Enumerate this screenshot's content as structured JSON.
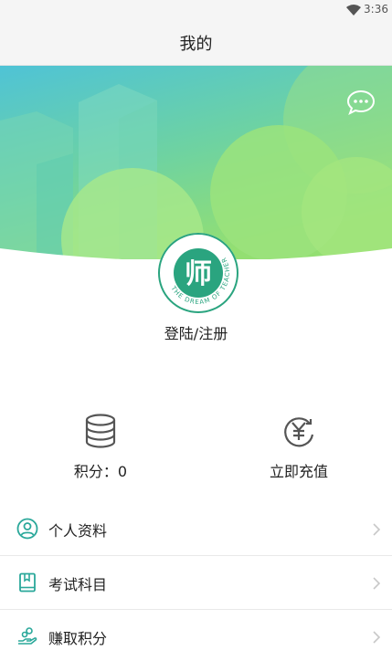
{
  "status_bar": {
    "time": "3:36"
  },
  "header": {
    "title": "我的"
  },
  "profile": {
    "avatar_text": "师",
    "avatar_ring_text": "THE DREAM OF TEACHER",
    "login_label": "登陆/注册"
  },
  "stats": {
    "points_label": "积分：0",
    "recharge_label": "立即充值"
  },
  "menu": {
    "items": [
      {
        "label": "个人资料",
        "icon": "user-circle-icon"
      },
      {
        "label": "考试科目",
        "icon": "book-icon"
      },
      {
        "label": "赚取积分",
        "icon": "earn-points-icon"
      }
    ]
  },
  "colors": {
    "accent": "#2aa47f",
    "banner_top": "#4fc3d6",
    "banner_bottom": "#8ddc72",
    "icon_gray": "#555555",
    "icon_teal": "#2aa89a"
  }
}
